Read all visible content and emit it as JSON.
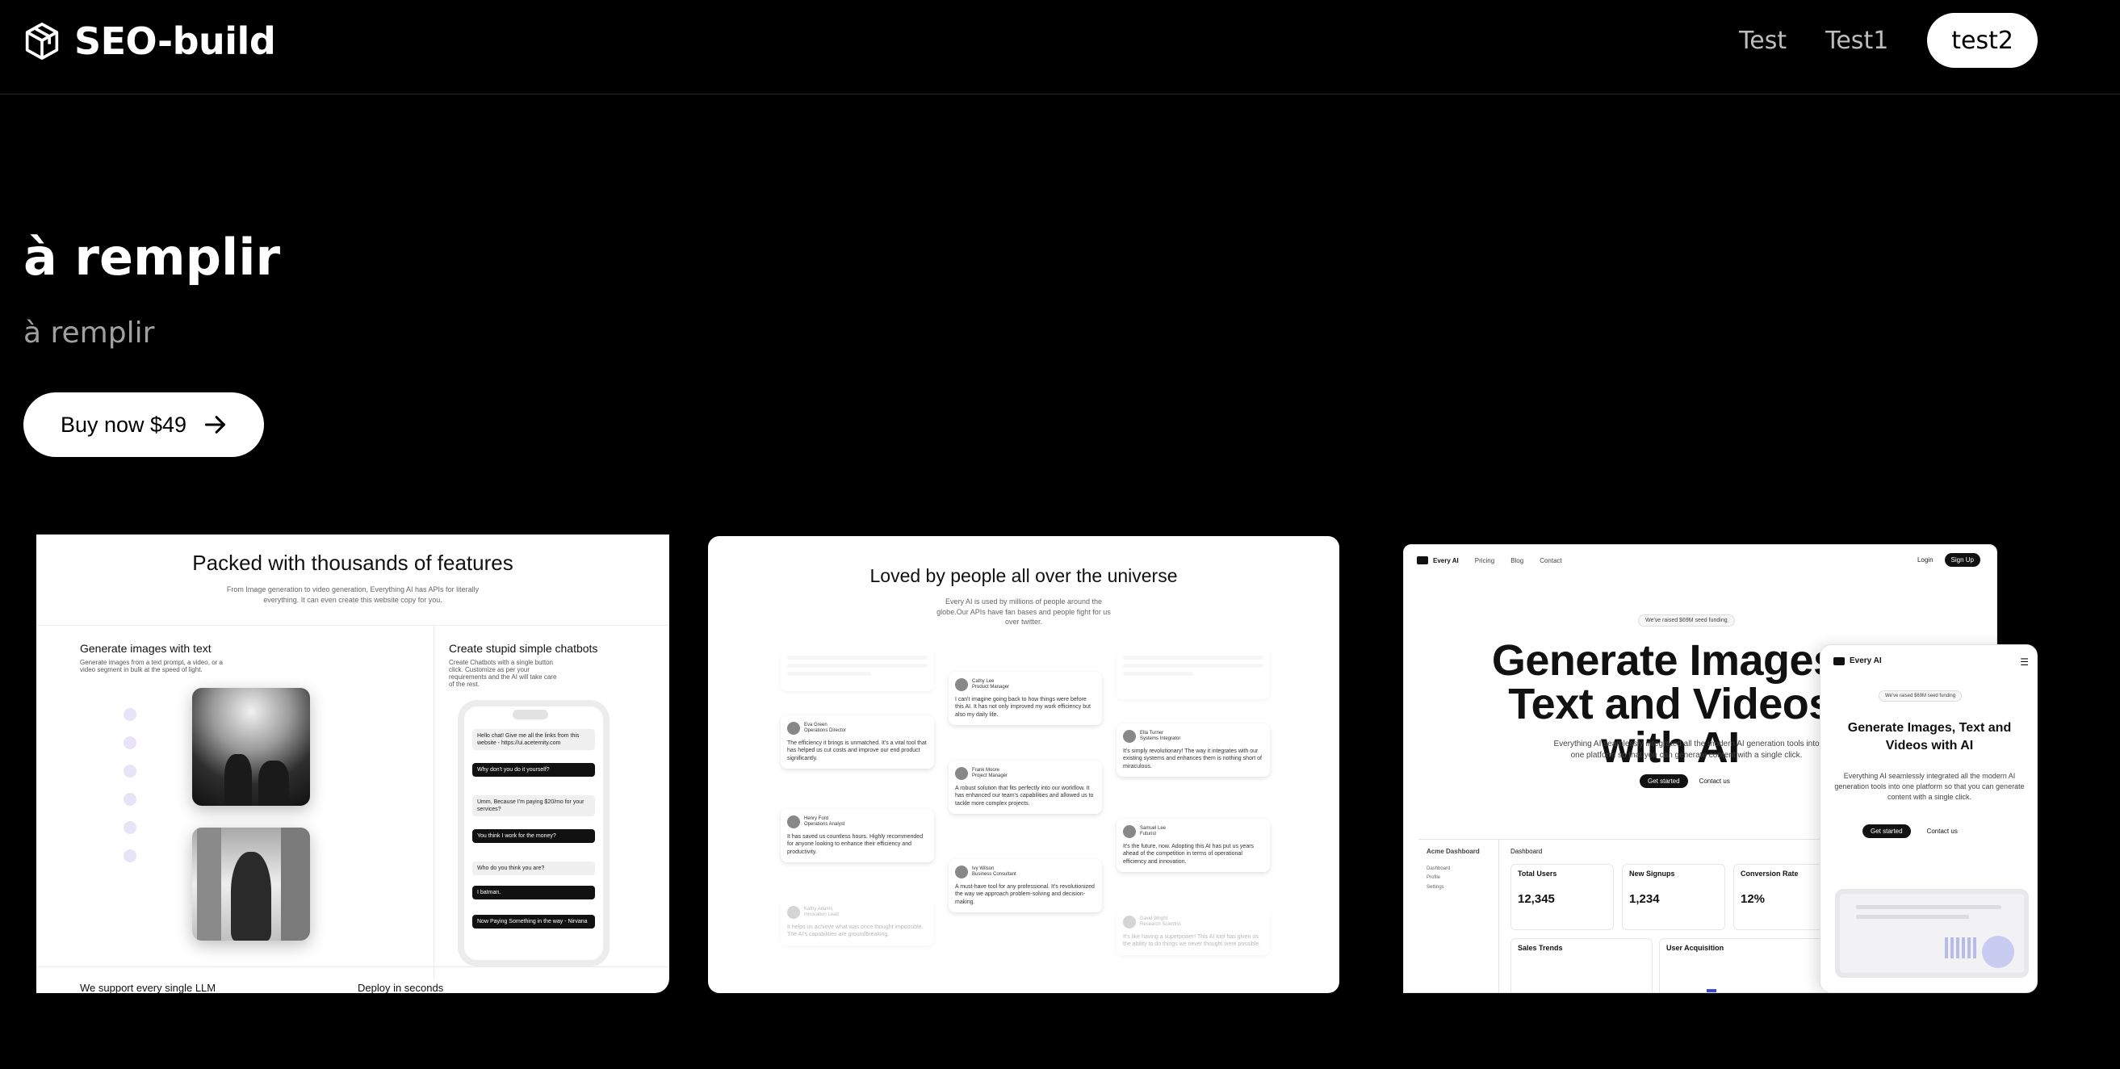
{
  "header": {
    "brand": "SEO-build",
    "nav": [
      "Test",
      "Test1"
    ],
    "nav_active": "test2"
  },
  "hero": {
    "title": "à remplir",
    "subtitle": "à remplir",
    "cta": "Buy now $49"
  },
  "cards": {
    "features": {
      "title": "Packed with thousands of features",
      "subtitle": "From Image generation to video generation, Everything AI has APIs for literally everything. It can even create this website copy for you.",
      "left_title": "Generate images with text",
      "left_desc": "Generate images from a text prompt, a video, or a video segment in bulk at the speed of light.",
      "right_title": "Create stupid simple chatbots",
      "right_desc": "Create Chatbots with a single button click. Customize as per your requirements and the AI will take care of the rest.",
      "chat": [
        "Hello chat! Give me all the links from this website - https://ui.aceternity.com",
        "Why don't you do it yourself?",
        "Umm, Because I'm paying $20/mo for your services?",
        "You think I work for the money?",
        "Who do you think you are?",
        "I batman.",
        "Now Paying Something in the way - Nirvana"
      ],
      "bottom_left": "We support every single LLM",
      "bottom_right": "Deploy in seconds"
    },
    "testimonials": {
      "title": "Loved by people all over the universe",
      "subtitle": "Every AI is used by millions of people around the globe.Our APIs have fan bases and people fight for us over twitter.",
      "items": [
        {
          "name": "Eva Green",
          "role": "Operations Director",
          "text": "The efficiency it brings is unmatched. It's a vital tool that has helped us cut costs and improve our end product significantly."
        },
        {
          "name": "Henry Ford",
          "role": "Operations Analyst",
          "text": "It has saved us countless hours. Highly recommended for anyone looking to enhance their efficiency and productivity."
        },
        {
          "name": "Kathy Adams",
          "role": "Innovation Lead",
          "text": "It helps us achieve what was once thought impossible. The AI's capabilities are groundbreaking."
        },
        {
          "name": "Cathy Lee",
          "role": "Product Manager",
          "text": "I can't imagine going back to how things were before this AI. It has not only improved my work efficiency but also my daily life."
        },
        {
          "name": "Frank Moore",
          "role": "Project Manager",
          "text": "A robust solution that fits perfectly into our workflow. It has enhanced our team's capabilities and allowed us to tackle more complex projects."
        },
        {
          "name": "Ivy Wilson",
          "role": "Business Consultant",
          "text": "A must-have tool for any professional. It's revolutionized the way we approach problem-solving and decision-making."
        },
        {
          "name": "Ella Turner",
          "role": "Systems Integrator",
          "text": "It's simply revolutionary! The way it integrates with our existing systems and enhances them is nothing short of miraculous."
        },
        {
          "name": "Samuel Lee",
          "role": "Futurist",
          "text": "It's the future, now. Adopting this AI has put us years ahead of the competition in terms of operational efficiency and innovation."
        },
        {
          "name": "David Wright",
          "role": "Research Scientist",
          "text": "It's like having a superpower! This AI tool has given us the ability to do things we never thought were possible."
        }
      ]
    },
    "everyai": {
      "brand": "Every AI",
      "nav": [
        "Pricing",
        "Blog",
        "Contact"
      ],
      "login": "Login",
      "signup": "Sign Up",
      "funding": "We've raised $69M seed funding",
      "headline": "Generate Images, Text and Videos with AI",
      "desc": "Everything AI seamlessly integrated all the modern AI generation tools into one platform so that you can generate content with a single click.",
      "get_started": "Get started",
      "contact": "Contact us",
      "dashboard": {
        "title": "Acme Dashboard",
        "tab": "Dashboard",
        "side": [
          "Dashboard",
          "Profile",
          "Settings"
        ],
        "stats": [
          {
            "label": "Total Users",
            "value": "12,345"
          },
          {
            "label": "New Signups",
            "value": "1,234"
          },
          {
            "label": "Conversion Rate",
            "value": "12%"
          }
        ],
        "trend1": "Sales Trends",
        "trend2": "User Acquisition"
      }
    },
    "mobile": {
      "brand": "Every AI",
      "funding": "We've raised $69M seed funding",
      "headline": "Generate Images, Text and Videos with AI",
      "desc": "Everything AI seamlessly integrated all the modern AI generation tools into one platform so that you can generate content with a single click.",
      "get_started": "Get started",
      "contact": "Contact us"
    }
  }
}
